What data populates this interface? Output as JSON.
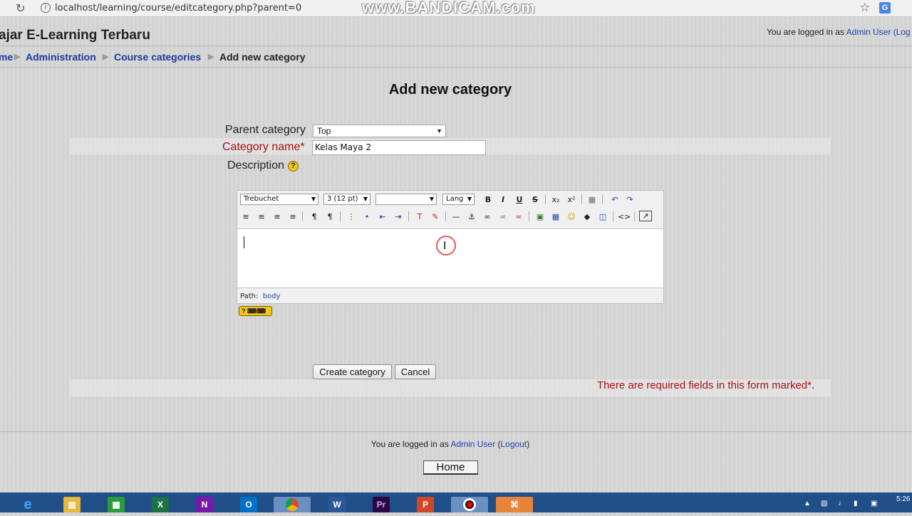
{
  "browser": {
    "url": "localhost/learning/course/editcategory.php?parent=0",
    "watermark": "www.BANDICAM.com"
  },
  "header": {
    "site_title": "ajar E-Learning Terbaru",
    "logged_in_prefix": "You are logged in as ",
    "user_name": "Admin User",
    "logout_partial": "(Log"
  },
  "breadcrumb": {
    "home": "me",
    "administration": "Administration",
    "course_categories": "Course categories",
    "current": "Add new category"
  },
  "page": {
    "title": "Add new category"
  },
  "form": {
    "parent_label": "Parent category",
    "parent_value": "Top",
    "name_label": "Category name",
    "required_mark": "*",
    "name_value": "Kelas Maya 2",
    "description_label": "Description",
    "help_glyph": "?"
  },
  "editor": {
    "font_family": "Trebuchet",
    "font_size": "3 (12 pt)",
    "heading": "",
    "lang": "Lang",
    "path_label": "Path:",
    "path_value": "body"
  },
  "actions": {
    "create_label": "Create category",
    "cancel_label": "Cancel"
  },
  "required_note": {
    "text": "There are required fields in this form marked",
    "mark": "*",
    "dot": "."
  },
  "footer": {
    "logged_in_prefix": "You are logged in as ",
    "user_name": "Admin User",
    "logout_open": " (",
    "logout_label": "Logout",
    "logout_close": ")",
    "home_label": "Home"
  },
  "taskbar": {
    "time": "5:26",
    "apps": [
      "ie-icon",
      "file-explorer-icon",
      "store-icon",
      "excel-icon",
      "onenote-icon",
      "outlook-icon",
      "chrome-icon",
      "word-icon",
      "premiere-icon",
      "powerpoint-icon",
      "bandicam-icon",
      "xampp-icon"
    ]
  }
}
